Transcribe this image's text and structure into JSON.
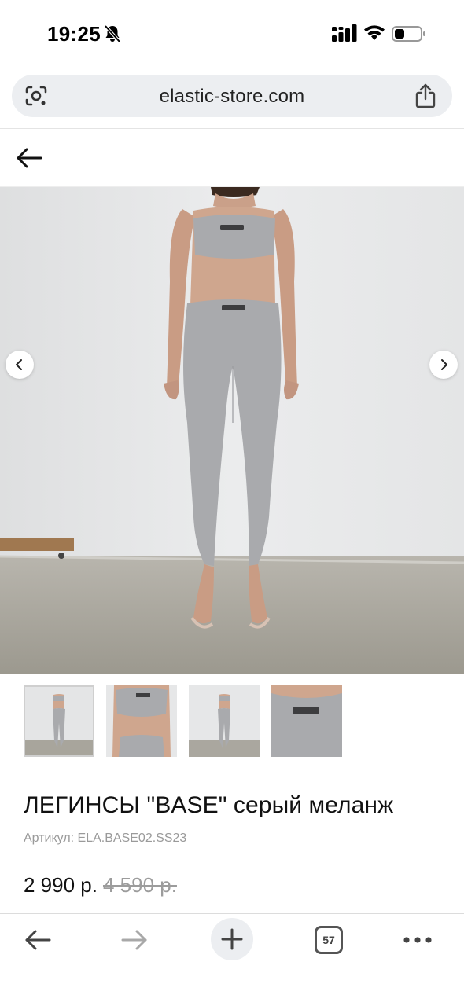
{
  "status_bar": {
    "time": "19:25",
    "icons": [
      "bell-slash-icon",
      "cellular-signal-icon",
      "wifi-icon",
      "battery-icon"
    ]
  },
  "address_bar": {
    "url": "elastic-store.com",
    "left_icon": "google-lens-icon",
    "right_icon": "share-icon"
  },
  "header": {
    "back_icon": "arrow-left-icon"
  },
  "gallery": {
    "main_image": "product-photo-model-grey-leggings",
    "prev_icon": "chevron-left-icon",
    "next_icon": "chevron-right-icon",
    "thumbnails": [
      "full-body-front",
      "top-close-up",
      "full-body-small",
      "waistband-close-up"
    ],
    "active_thumbnail": 0
  },
  "product": {
    "title": "ЛЕГИНСЫ \"BASE\" серый меланж",
    "sku": "Артикул: ELA.BASE02.SS23",
    "price_current": "2 990 р.",
    "price_old": "4 590 р."
  },
  "toolbar": {
    "tab_count": "57",
    "icons": [
      "arrow-left-icon",
      "arrow-right-icon",
      "plus-icon",
      "tabs-icon",
      "more-horizontal-icon"
    ]
  },
  "colors": {
    "address_bar_bg": "#eceef1",
    "product_fabric": "#a9aaad",
    "wall": "#e6e7e8",
    "floor": "#a7a49b"
  }
}
